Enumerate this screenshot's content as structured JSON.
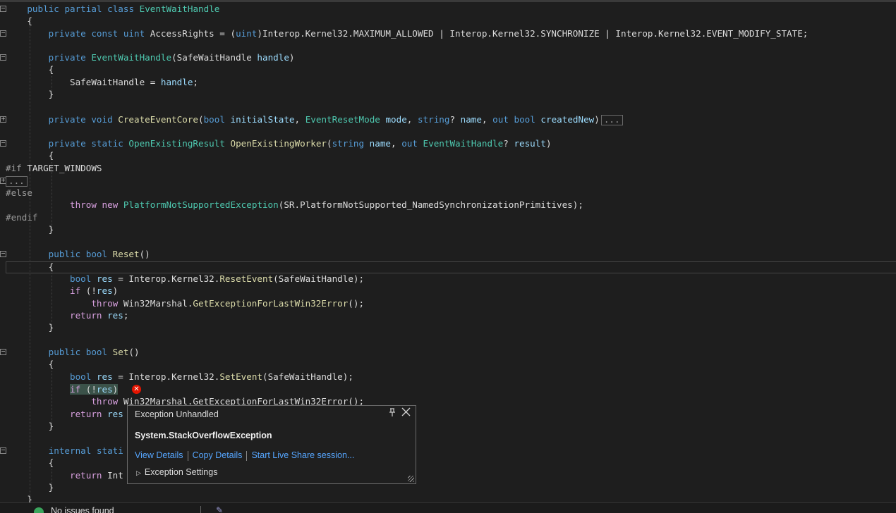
{
  "code": {
    "class_kw1": "public",
    "class_kw2": "partial",
    "class_kw3": "class",
    "class_name": "EventWaitHandle",
    "brace_open": "{",
    "brace_close": "}",
    "l3_kw": "private const uint",
    "l3_name": " AccessRights = (",
    "l3_cast": "uint",
    "l3_rest": ")Interop.Kernel32.MAXIMUM_ALLOWED | Interop.Kernel32.SYNCHRONIZE | Interop.Kernel32.EVENT_MODIFY_STATE;",
    "l5_kw": "private",
    "l5_ctor": "EventWaitHandle",
    "l5_open": "(SafeWaitHandle ",
    "l5_param": "handle",
    "l5_close": ")",
    "l7_text": "SafeWaitHandle = ",
    "l7_param": "handle",
    "l7_end": ";",
    "l10_kw": "private void",
    "l10_fn": "CreateEventCore",
    "l10_p1_kw": "bool",
    "l10_p1": "initialState",
    "l10_p2_ty": "EventResetMode",
    "l10_p2": "mode",
    "l10_p3_kw": "string",
    "l10_p3": "name",
    "l10_p4_kw": "out bool",
    "l10_p4": "createdNew",
    "collapsed": "...",
    "l12_kw": "private static",
    "l12_ty": "OpenExistingResult",
    "l12_fn": "OpenExistingWorker",
    "l12_p1_kw": "string",
    "l12_p1": "name",
    "l12_p2_kw": "out",
    "l12_p2_ty": "EventWaitHandle",
    "l12_p2": "result",
    "pp_if": "#if",
    "pp_if_sym": " TARGET_WINDOWS",
    "pp_else": "#else",
    "pp_endif": "#endif",
    "l17_kw": "throw new",
    "l17_ty": "PlatformNotSupportedException",
    "l17_rest": "(SR.PlatformNotSupported_NamedSynchronizationPrimitives);",
    "reset_kw": "public bool",
    "reset_fn": "Reset",
    "parens": "()",
    "l23_kw": "bool",
    "l23_var": "res",
    "l23_mid": " = Interop.Kernel32.",
    "l23_fn": "ResetEvent",
    "l23_end": "(SafeWaitHandle);",
    "if_kw": "if",
    "if_rest": " (!",
    "if_close": ")",
    "throw_kw": "throw",
    "throw_rest": " Win32Marshal.",
    "throw_fn": "GetExceptionForLastWin32Error",
    "throw_end": "();",
    "return_kw": "return",
    "return_end": ";",
    "set_kw": "public bool",
    "set_fn": "Set",
    "l31_fn": "SetEvent",
    "l36_partial": "return res",
    "internal_kw": "internal",
    "internal_partial": "stati",
    "l39_partial": "Int",
    "throw_short": " Wi",
    "throw_short_rest": "n32Marshal.GetExceptionForLastWin32Error();"
  },
  "popup": {
    "title": "Exception Unhandled",
    "exception": "System.StackOverflowException",
    "link_view": "View Details",
    "link_copy": "Copy Details",
    "link_share": "Start Live Share session...",
    "settings": "Exception Settings"
  },
  "status": {
    "issues": "No issues found"
  }
}
